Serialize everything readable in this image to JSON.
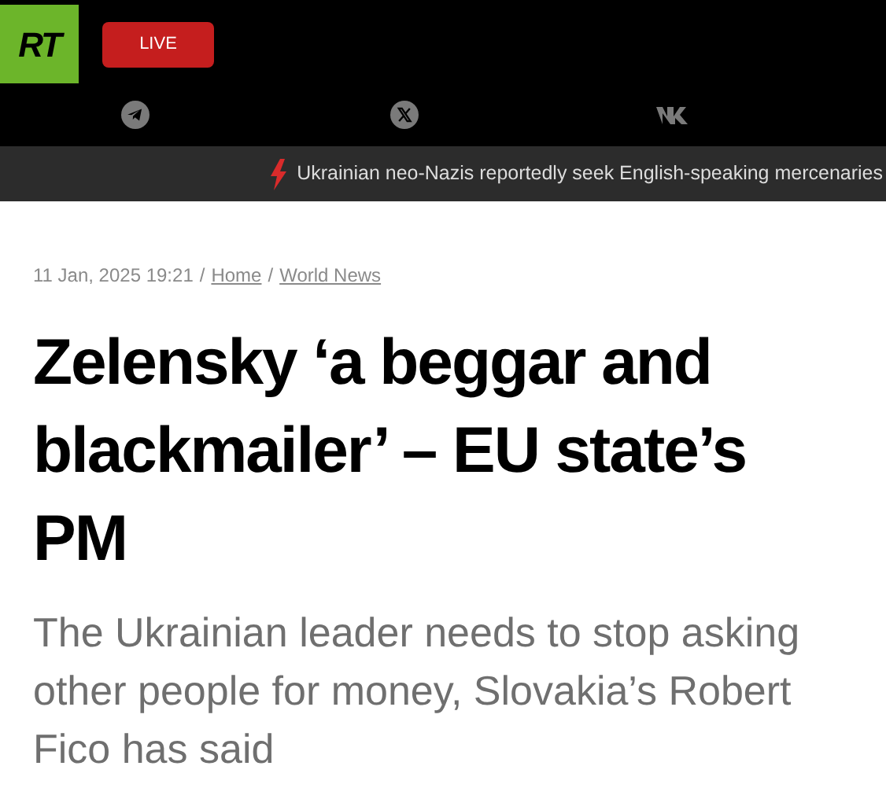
{
  "header": {
    "logo": "RT",
    "live_button": "LIVE",
    "social_icons": [
      {
        "kind": "telegram"
      },
      {
        "kind": "x"
      },
      {
        "kind": "vk"
      }
    ]
  },
  "ticker": {
    "headline": "Ukrainian neo-Nazis reportedly seek English-speaking mercenaries"
  },
  "breadcrumb": {
    "date": "11 Jan, 2025 19:21",
    "separator": "/",
    "links": [
      "Home",
      "World News"
    ]
  },
  "article": {
    "title": "Zelensky ‘a beggar and blackmailer’ – EU state’s PM",
    "summary": "The Ukrainian leader needs to stop asking other people for money, Slovakia’s Robert Fico has said"
  }
}
